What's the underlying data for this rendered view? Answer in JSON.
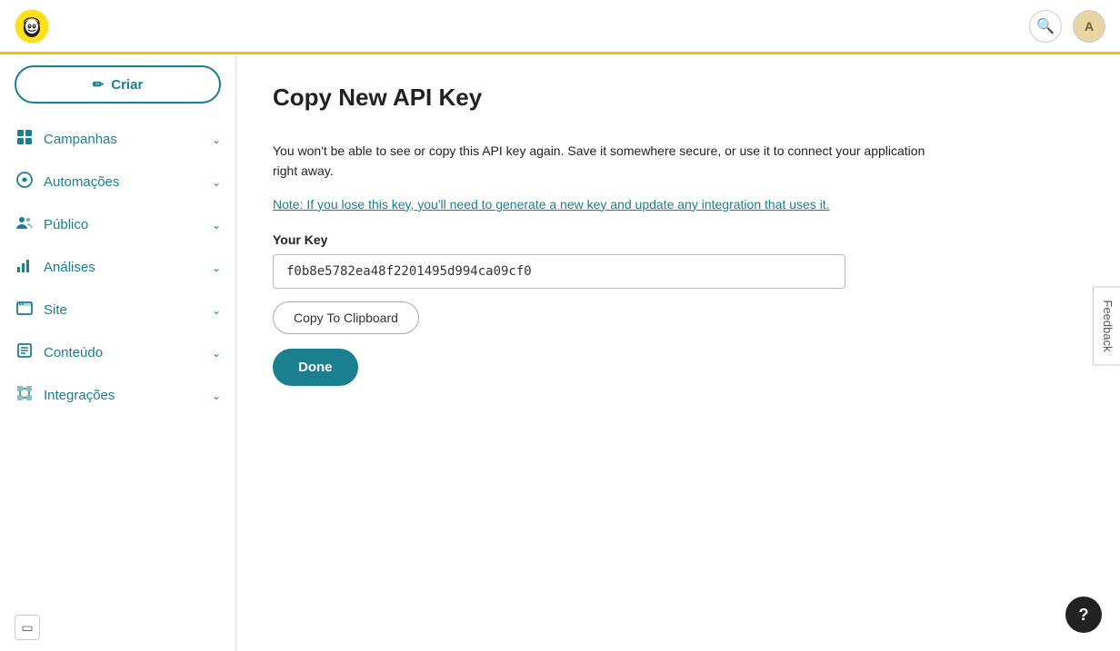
{
  "topbar": {
    "search_label": "Search",
    "avatar_label": "A"
  },
  "sidebar": {
    "criar_label": "Criar",
    "criar_icon": "✏",
    "items": [
      {
        "id": "campanhas",
        "label": "Campanhas",
        "icon": "⊞"
      },
      {
        "id": "automacoes",
        "label": "Automações",
        "icon": "↻"
      },
      {
        "id": "publico",
        "label": "Público",
        "icon": "⊟"
      },
      {
        "id": "analises",
        "label": "Análises",
        "icon": "▦"
      },
      {
        "id": "site",
        "label": "Site",
        "icon": "▣"
      },
      {
        "id": "conteudo",
        "label": "Conteúdo",
        "icon": "▤"
      },
      {
        "id": "integracoes",
        "label": "Integrações",
        "icon": "⊞"
      }
    ],
    "collapse_icon": "▣"
  },
  "main": {
    "page_title": "Copy New API Key",
    "warning_text": "You won't be able to see or copy this API key again. Save it somewhere secure, or use it to connect your application right away.",
    "note_prefix": "Note: ",
    "note_link": "If you lose this key, you'll need to generate a new key and update any integration that uses it.",
    "your_key_label": "Your Key",
    "api_key_value": "f0b8e5782ea48f2201495d994ca09cf0",
    "copy_button_label": "Copy To Clipboard",
    "done_button_label": "Done"
  },
  "feedback": {
    "label": "Feedback"
  },
  "help": {
    "label": "?"
  }
}
